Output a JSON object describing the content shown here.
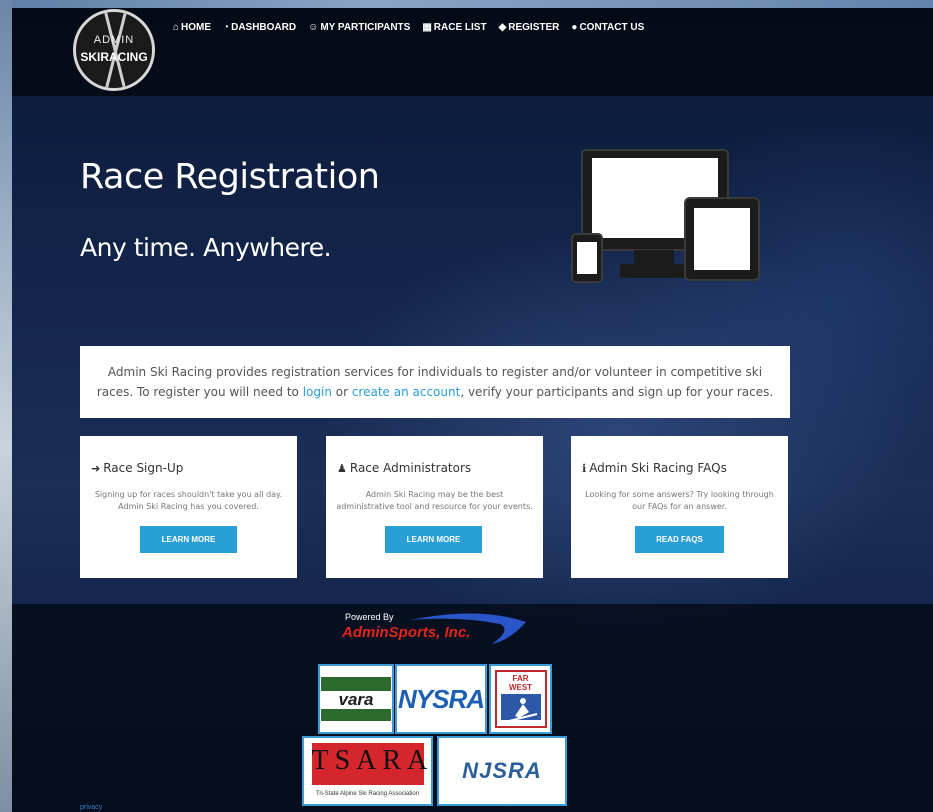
{
  "brand": {
    "logo_top": "ADMIN",
    "logo_bottom": "SKIRACING"
  },
  "nav": {
    "items": [
      {
        "icon": "home-icon",
        "glyph": "⌂",
        "label": "HOME"
      },
      {
        "icon": "dashboard-icon",
        "glyph": "◔",
        "label": "DASHBOARD"
      },
      {
        "icon": "users-icon",
        "glyph": "☺",
        "label": "MY PARTICIPANTS"
      },
      {
        "icon": "calendar-icon",
        "glyph": "▦",
        "label": "RACE LIST"
      },
      {
        "icon": "tag-icon",
        "glyph": "◆",
        "label": "REGISTER"
      },
      {
        "icon": "chat-icon",
        "glyph": "●",
        "label": "CONTACT US"
      }
    ]
  },
  "hero": {
    "title": "Race Registration",
    "subtitle": "Any time. Anywhere."
  },
  "intro": {
    "text_before": "Admin Ski Racing provides registration services for individuals to register and/or volunteer in competitive ski races.  To register you will need to ",
    "login_link": "login",
    "text_middle": " or ",
    "create_link": "create an account",
    "text_after": ", verify your participants and sign up for your races."
  },
  "cards": [
    {
      "icon": "sign-in-icon",
      "glyph": "➜",
      "title": "Race Sign-Up",
      "text": "Signing up for races shouldn't take you all day. Admin Ski Racing has you covered.",
      "button": "LEARN MORE"
    },
    {
      "icon": "user-icon",
      "glyph": "♟",
      "title": "Race Administrators",
      "text": "Admin Ski Racing may be the best administrative tool and resource for your events.",
      "button": "LEARN MORE"
    },
    {
      "icon": "info-icon",
      "glyph": "ℹ",
      "title": "Admin Ski Racing FAQs",
      "text": "Looking for some answers? Try looking through our FAQs for an answer.",
      "button": "READ FAQS"
    }
  ],
  "footer": {
    "powered_by": "Powered By",
    "powered_brand": "AdminSports, Inc.",
    "associations": {
      "vara": "vara",
      "nysra": "NYSRA",
      "farwest_1": "FAR",
      "farwest_2": "WEST",
      "tsara": "TSARA",
      "tsara_caption": "Tri-State Alpine Ski Racing Association",
      "njsra": "NJSRA"
    },
    "privacy": "privacy"
  },
  "colors": {
    "accent": "#2a9fd6",
    "nav_bg": "#04080f",
    "hero_bg": "#15274f"
  }
}
